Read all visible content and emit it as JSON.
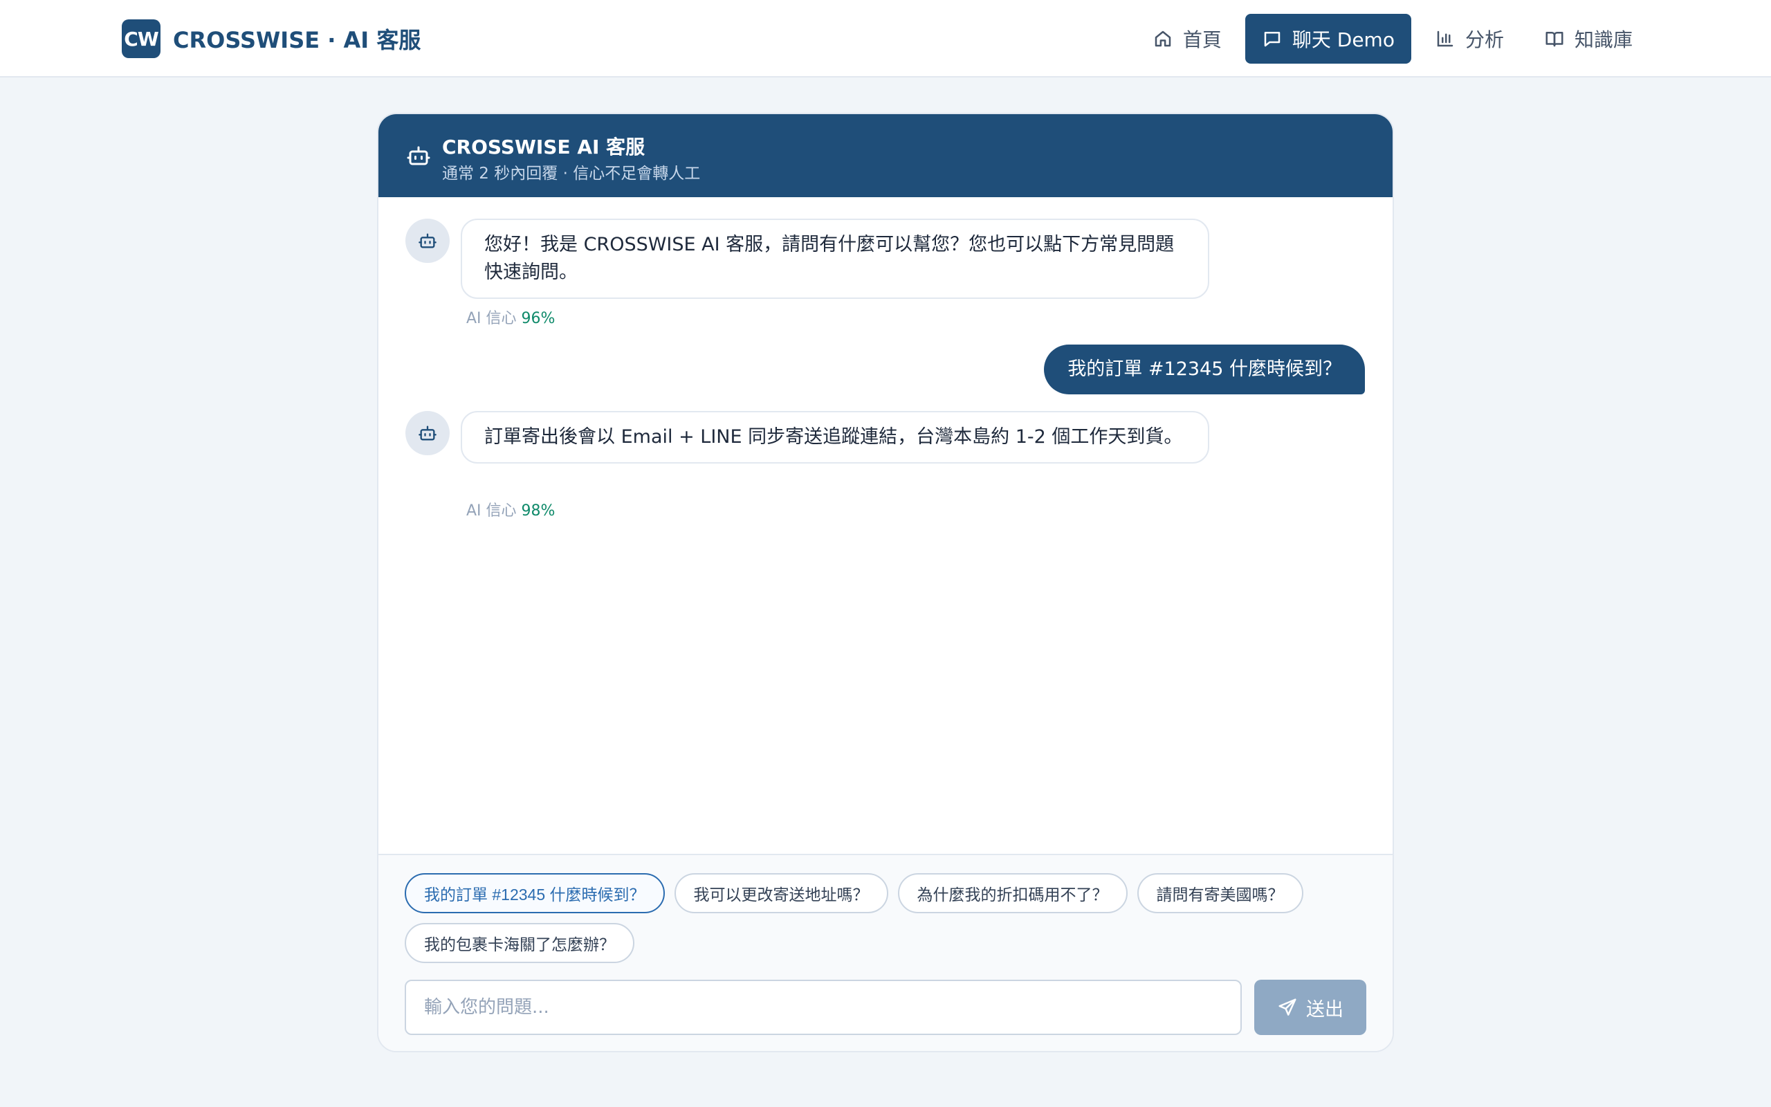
{
  "brand": {
    "logo": "CW",
    "name": "CROSSWISE · AI 客服"
  },
  "nav": {
    "items": [
      {
        "label": "首頁",
        "icon": "home-icon"
      },
      {
        "label": "聊天 Demo",
        "icon": "chat-icon",
        "active": true
      },
      {
        "label": "分析",
        "icon": "bar-chart-icon"
      },
      {
        "label": "知識庫",
        "icon": "book-icon"
      }
    ]
  },
  "chat": {
    "title": "CROSSWISE AI 客服",
    "subtitle": "通常 2 秒內回覆 · 信心不足會轉人工",
    "messages": [
      {
        "from": "bot",
        "text": "您好！我是 CROSSWISE AI 客服，請問有什麼可以幫您？您也可以點下方常見問題快速詢問。",
        "confidence_label": "AI 信心",
        "confidence": "96%"
      },
      {
        "from": "user",
        "text": "我的訂單 #12345 什麼時候到？"
      },
      {
        "from": "bot",
        "text": "訂單寄出後會以 Email + LINE 同步寄送追蹤連結，台灣本島約 1-2 個工作天到貨。",
        "confidence_label": "AI 信心",
        "confidence": "98%"
      }
    ],
    "quick_replies": [
      "我的訂單 #12345 什麼時候到？",
      "我可以更改寄送地址嗎？",
      "為什麼我的折扣碼用不了？",
      "請問有寄美國嗎？",
      "我的包裹卡海關了怎麼辦？"
    ],
    "input_placeholder": "輸入您的問題...",
    "send_label": "送出"
  },
  "colors": {
    "primary": "#1f4e79",
    "confidence": "#0f8a6a",
    "send_disabled": "#8fa9c4",
    "background": "#f1f5f9"
  }
}
